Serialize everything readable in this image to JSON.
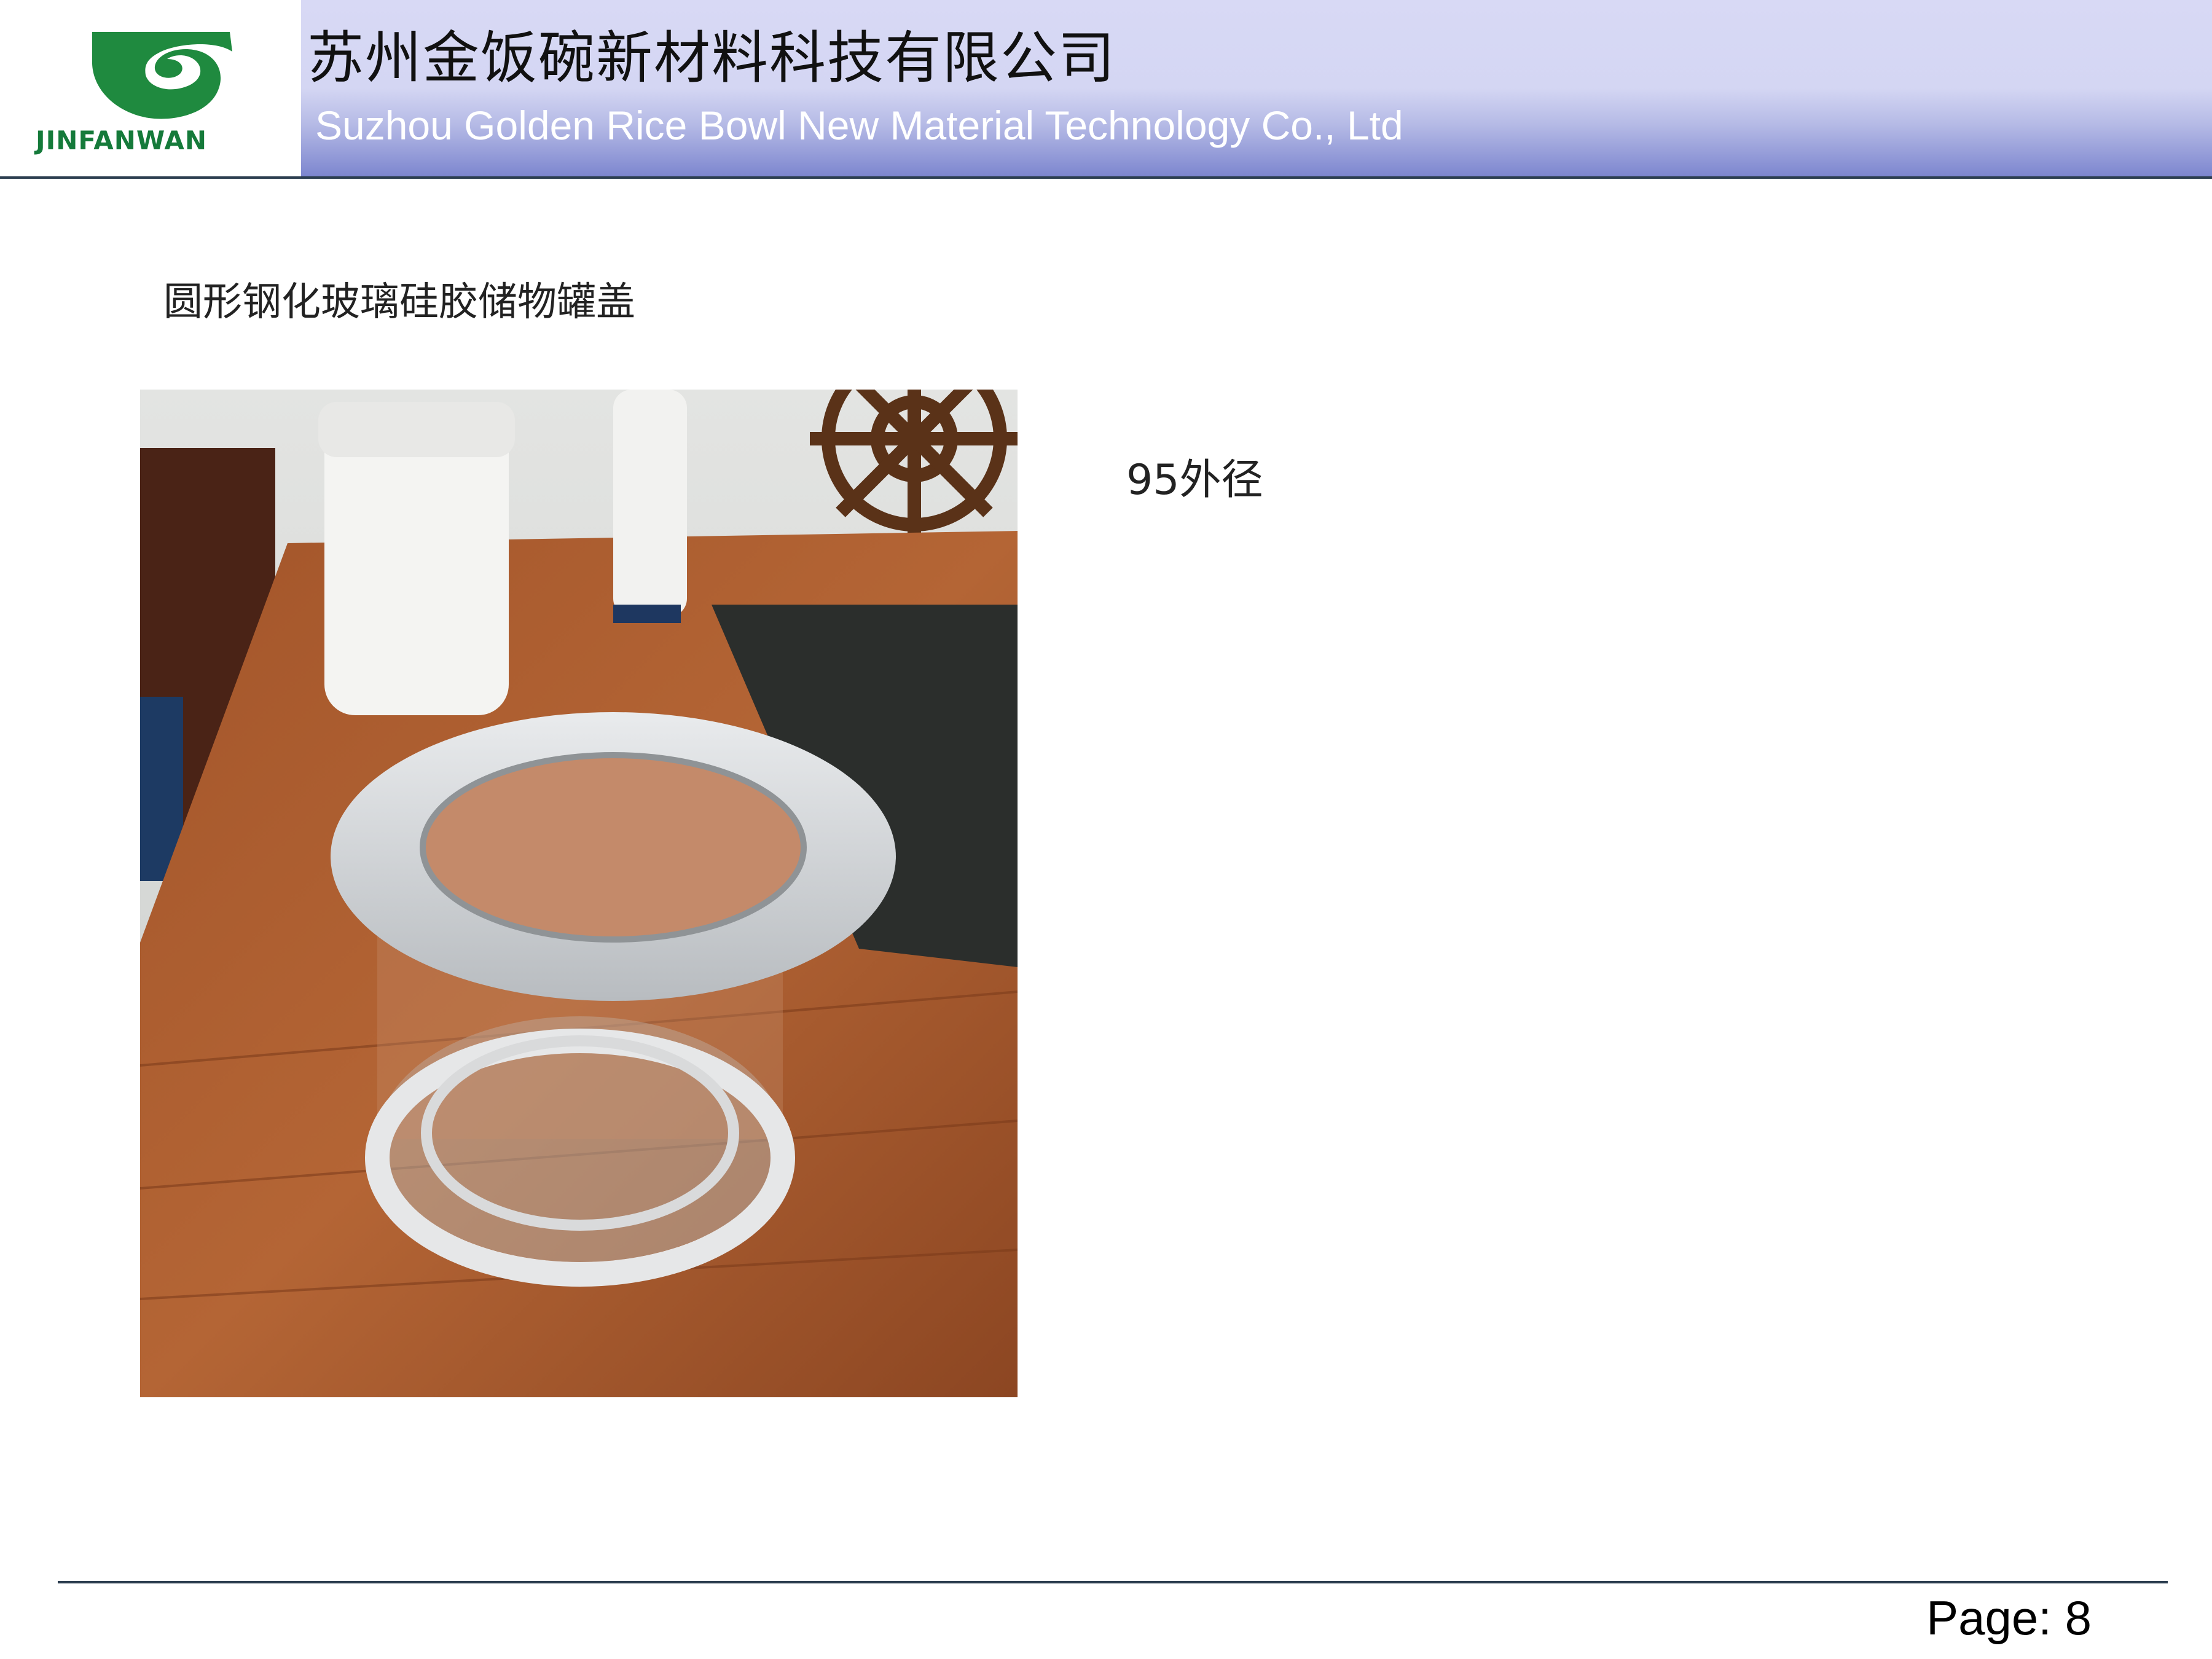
{
  "header": {
    "logo_text": "JINFANWAN",
    "company_name_cn": "苏州金饭碗新材料科技有限公司",
    "company_name_en": "Suzhou Golden Rice Bowl New Material Technology Co., Ltd"
  },
  "content": {
    "product_name": "圆形钢化玻璃硅胶储物罐盖",
    "spec_text": "95外径"
  },
  "footer": {
    "page_label": "Page: 8"
  },
  "colors": {
    "brand_green": "#157a3a",
    "header_band_top": "#d8d9f5",
    "header_band_bottom": "#7d86cf",
    "rule": "#2c3e50"
  }
}
